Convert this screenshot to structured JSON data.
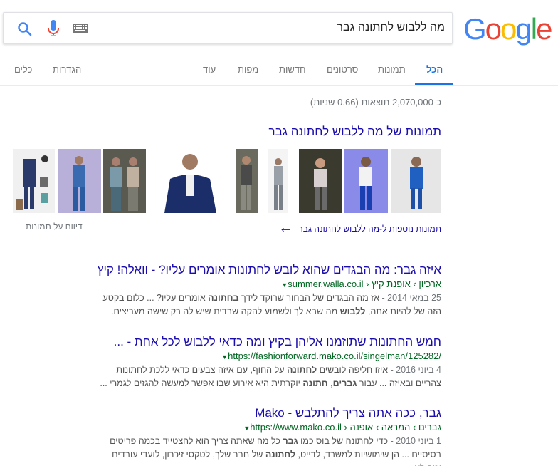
{
  "header": {
    "logo": {
      "g1": "G",
      "o1": "o",
      "o2": "o",
      "g2": "g",
      "l": "l",
      "e": "e"
    },
    "search_query": "מה ללבוש לחתונה גבר"
  },
  "tabs": [
    {
      "label": "הכל",
      "active": true
    },
    {
      "label": "תמונות"
    },
    {
      "label": "סרטונים"
    },
    {
      "label": "חדשות"
    },
    {
      "label": "מפות"
    },
    {
      "label": "עוד"
    },
    {
      "label": "הגדרות"
    },
    {
      "label": "כלים"
    }
  ],
  "result_stats": "כ-2,070,000 תוצאות (0.66 שניות)",
  "images": {
    "heading": "תמונות של מה ללבוש לחתונה גבר",
    "more_link": "תמונות נוספות ל-מה ללבוש לחתונה גבר",
    "report": "דיווח על תמונות"
  },
  "results": [
    {
      "title": "איזה גבר: מה הבגדים שהוא לובש לחתונות אומרים עליו? - וואלה! קיץ",
      "url": "summer.walla.co.il › ארכיון › אופנת קיץ",
      "date": "25 במאי 2014 -",
      "snippet_1": " אז מה הבגדים של הבחור שרוקד לידך ",
      "bold_1": "בחתונה",
      "snippet_2": " אומרים עליו? ... כלום בקטע הזה של להיות אתה, ",
      "bold_2": "ללבוש",
      "snippet_3": " מה שבא לך ולשמוע להקה שבדית שיש לה רק שישה מעריצים."
    },
    {
      "title": "חמש החתונות שתוזמנו אליהן בקיץ ומה כדאי ללבוש לכל אחת - ...",
      "url": "https://fashionforward.mako.co.il/singelman/125282/",
      "date": "4 ביוני 2016 -",
      "snippet_1": " איזו חליפה לובשים ",
      "bold_1": "לחתונה",
      "snippet_2": " על החוף, עם איזה צבעים כדאי ללכת לחתונות צהריים ובאיזה ... עבור ",
      "bold_2": "גברים",
      "snippet_3": ", ",
      "bold_3": "חתונה",
      "snippet_4": " יוקרתית היא אירוע שבו אפשר למעשה להגזים לגמרי ..."
    },
    {
      "title": "גבר, ככה אתה צריך להתלבש - Mako",
      "url": "https://www.mako.co.il › גברים › המראה › אופנה",
      "date": "1 ביוני 2010 -",
      "snippet_1": " כדי לחתונה של בוס כמו ",
      "bold_1": "גבר",
      "snippet_2": " כל מה שאתה צריך הוא להצטייד בכמה פריטים בסיסיים ... הן שימושיות למשרד, לדייט, ",
      "bold_2": "לחתונה",
      "snippet_3": " של חבר שלך, לטקסי זיכרון, לועדי עובדים ומה לא."
    }
  ],
  "colors": {
    "link": "#1a0dab",
    "url": "#006621",
    "accent": "#1a73e8"
  },
  "icons": [
    "search-icon",
    "microphone-icon",
    "keyboard-icon",
    "arrow-left-icon"
  ]
}
